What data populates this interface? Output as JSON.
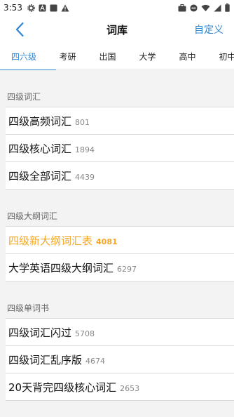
{
  "status_bar": {
    "time": "3:53",
    "icons_left": [
      "settings-icon",
      "a-notification-icon",
      "square-notification-icon",
      "warning-icon"
    ],
    "icons_right": [
      "briefcase-icon",
      "dnd-icon",
      "wifi-icon",
      "signal-icon",
      "battery-icon"
    ]
  },
  "header": {
    "title": "词库",
    "custom_label": "自定义"
  },
  "tabs": [
    {
      "label": "四六级",
      "active": true
    },
    {
      "label": "考研",
      "active": false
    },
    {
      "label": "出国",
      "active": false
    },
    {
      "label": "大学",
      "active": false
    },
    {
      "label": "高中",
      "active": false
    },
    {
      "label": "初中",
      "active": false
    }
  ],
  "sections": [
    {
      "title": "四级词汇",
      "items": [
        {
          "name": "四级高频词汇",
          "count": "801"
        },
        {
          "name": "四级核心词汇",
          "count": "1894"
        },
        {
          "name": "四级全部词汇",
          "count": "4439"
        }
      ]
    },
    {
      "title": "四级大纲词汇",
      "items": [
        {
          "name": "四级新大纲词汇表",
          "count": "4081",
          "highlight": true
        },
        {
          "name": "大学英语四级大纲词汇",
          "count": "6297"
        }
      ]
    },
    {
      "title": "四级单词书",
      "items": [
        {
          "name": "四级词汇闪过",
          "count": "5708"
        },
        {
          "name": "四级词汇乱序版",
          "count": "4674"
        },
        {
          "name": "20天背完四级核心词汇",
          "count": "2653"
        }
      ]
    }
  ],
  "colors": {
    "accent": "#2f86d6",
    "highlight": "#f5a623",
    "background": "#f3f3f3"
  }
}
